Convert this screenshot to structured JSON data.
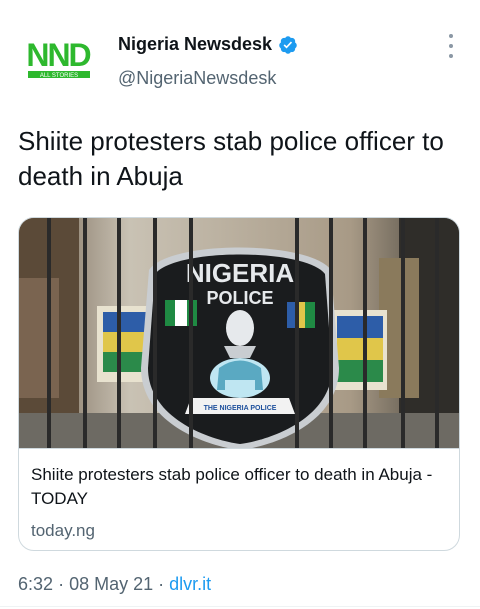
{
  "account": {
    "display_name": "Nigeria Newsdesk",
    "handle": "@NigeriaNewsdesk",
    "verified": true,
    "avatar_logo_text": "NND",
    "avatar_sub_text": "ALL STORIES"
  },
  "tweet": {
    "text": "Shiite protesters stab police officer to death in Abuja",
    "time": "6:32",
    "date": "08 May 21",
    "source": "dlvr.it"
  },
  "card": {
    "title": "Shiite protesters stab police officer to death in Abuja - TODAY",
    "domain": "today.ng",
    "image": {
      "badge_text_top": "NIGERIA",
      "badge_text_middle": "POLICE",
      "badge_ribbon_text": "THE NIGERIA POLICE"
    }
  },
  "colors": {
    "text": "#0f1419",
    "secondary": "#536471",
    "link": "#1d9bf0",
    "brand_green": "#2eb82e",
    "verified_blue": "#1d9bf0"
  },
  "icons": {
    "verified": "verified-badge-icon",
    "more": "more-options-icon"
  }
}
